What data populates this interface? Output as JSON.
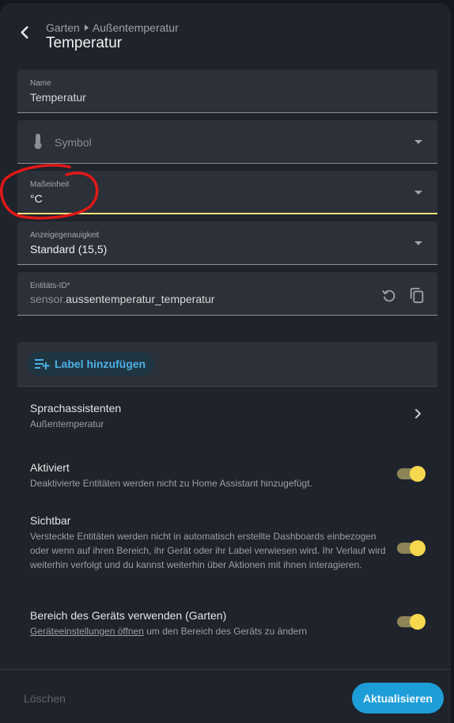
{
  "header": {
    "breadcrumb": [
      "Garten",
      "Außentemperatur"
    ],
    "title": "Temperatur"
  },
  "fields": {
    "name": {
      "label": "Name",
      "value": "Temperatur"
    },
    "symbol": {
      "placeholder": "Symbol",
      "icon": "thermometer-icon"
    },
    "unit": {
      "label": "Maßeinheit",
      "value": "°C"
    },
    "precision": {
      "label": "Anzeigegenauigkeit",
      "value": "Standard (15,5)"
    },
    "entity_id": {
      "label": "Entitäts-ID*",
      "prefix": "sensor.",
      "value": "aussentemperatur_temperatur"
    }
  },
  "labels": {
    "add_label": "Label hinzufügen"
  },
  "voice": {
    "title": "Sprachassistenten",
    "subtitle": "Außentemperatur"
  },
  "enabled": {
    "title": "Aktiviert",
    "description": "Deaktivierte Entitäten werden nicht zu Home Assistant hinzugefügt.",
    "on": true
  },
  "visible": {
    "title": "Sichtbar",
    "description": "Versteckte Entitäten werden nicht in automatisch erstellte Dashboards einbezogen oder wenn auf ihren Bereich, ihr Gerät oder ihr Label verwiesen wird. Ihr Verlauf wird weiterhin verfolgt und du kannst weiterhin über Aktionen mit ihnen interagieren.",
    "on": true
  },
  "use_device_area": {
    "title": "Bereich des Geräts verwenden (Garten)",
    "link": "Geräteeinstellungen öffnen",
    "description_rest": " um den Bereich des Geräts zu ändern",
    "on": true
  },
  "footer": {
    "delete": "Löschen",
    "update": "Aktualisieren"
  },
  "colors": {
    "accent": "#1e9ed9",
    "focus_underline": "#f1e17b",
    "toggle_knob": "#f5d84e",
    "annotation": "#e01818"
  }
}
